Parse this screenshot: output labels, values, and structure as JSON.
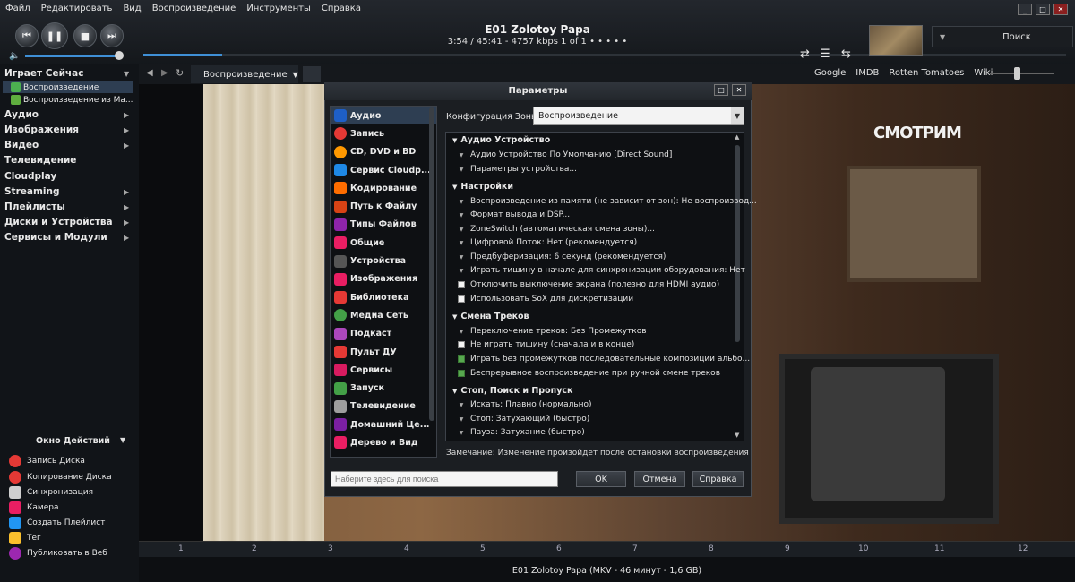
{
  "menu": [
    "Файл",
    "Редактировать",
    "Вид",
    "Воспроизведение",
    "Инструменты",
    "Справка"
  ],
  "player": {
    "title": "E01 Zolotoy Papa",
    "info": "3:54 / 45:41 - 4757 kbps   1 of 1   • • • • •",
    "progress": 0.085,
    "volume": 0.92,
    "search_label": "Поиск"
  },
  "toolbar": {
    "view_tab": "Воспроизведение",
    "links": [
      "Google",
      "IMDB",
      "Rotten Tomatoes",
      "Wiki"
    ]
  },
  "sidebar": {
    "now_playing": "Играет Сейчас",
    "subitems": [
      "Воспроизведение",
      "Воспроизведение из Ма..."
    ],
    "items": [
      "Аудио",
      "Изображения",
      "Видео",
      "Телевидение",
      "Cloudplay",
      "Streaming",
      "Плейлисты",
      "Диски и Устройства",
      "Сервисы и Модули"
    ],
    "actions_title": "Окно Действий",
    "actions": [
      "Запись Диска",
      "Копирование Диска",
      "Синхронизация",
      "Камера",
      "Создать Плейлист",
      "Тег",
      "Публиковать в Веб"
    ]
  },
  "video": {
    "logo": "СМОТРИМ"
  },
  "timeline": [
    "1",
    "2",
    "3",
    "4",
    "5",
    "6",
    "7",
    "8",
    "9",
    "10",
    "11",
    "12"
  ],
  "status": "E01 Zolotoy Papa (MKV - 46 минут - 1,6 GB)",
  "dialog": {
    "title": "Параметры",
    "categories": [
      "Аудио",
      "Запись",
      "CD, DVD и BD",
      "Сервис Cloudp...",
      "Кодирование",
      "Путь к Файлу",
      "Типы Файлов",
      "Общие",
      "Устройства",
      "Изображения",
      "Библиотека",
      "Медиа Сеть",
      "Подкаст",
      "Пульт ДУ",
      "Сервисы",
      "Запуск",
      "Телевидение",
      "Домашний Це...",
      "Дерево и Вид"
    ],
    "zone_label": "Конфигурация Зоны:",
    "zone_value": "Воспроизведение",
    "groups": {
      "g1": "Аудио Устройство",
      "g2": "Настройки",
      "g3": "Смена Треков",
      "g4": "Стоп, Поиск и Пропуск"
    },
    "rows": {
      "r1": "Аудио Устройство По Умолчанию [Direct Sound]",
      "r2": "Параметры устройства...",
      "r3": "Воспроизведение из памяти (не зависит от зон): Не воспроизвод...",
      "r4": "Формат вывода и DSP...",
      "r5": "ZoneSwitch (автоматическая смена зоны)...",
      "r6": "Цифровой Поток: Нет (рекомендуется)",
      "r7": "Предбуферизация: 6 секунд (рекомендуется)",
      "r8": "Играть тишину в начале для синхронизации оборудования: Нет",
      "r9": "Отключить выключение экрана (полезно для HDMI аудио)",
      "r10": "Использовать SoX для дискретизации",
      "r11": "Переключение треков: Без Промежутков",
      "r12": "Не играть тишину (сначала и в конце)",
      "r13": "Играть без промежутков последовательные композиции альбо...",
      "r14": "Беспрерывное воспроизведение при ручной смене треков",
      "r15": "Искать: Плавно (нормально)",
      "r16": "Стоп: Затухающий (быстро)",
      "r17": "Пауза: Затухание (быстро)"
    },
    "note": "Замечание: Изменение произойдет после остановки воспроизведения",
    "search_placeholder": "Наберите здесь для поиска",
    "ok": "OK",
    "cancel": "Отмена",
    "help": "Справка"
  }
}
